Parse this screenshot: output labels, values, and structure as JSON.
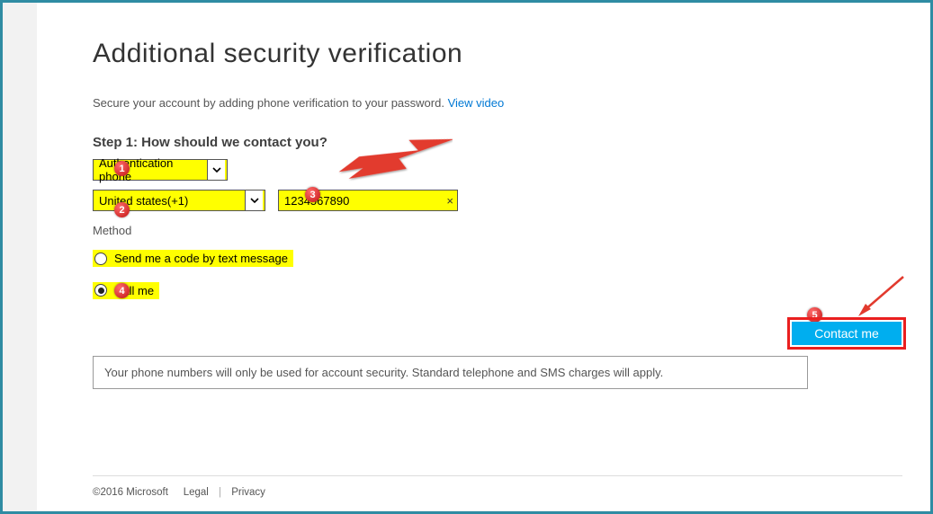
{
  "header": {
    "title": "Additional security verification"
  },
  "subtitle": {
    "text": "Secure your account by adding phone verification to your password. ",
    "link": "View video"
  },
  "step": {
    "title": "Step 1: How should we contact you?"
  },
  "auth_method": {
    "selected": "Authentication phone"
  },
  "country": {
    "selected": "United states(+1)"
  },
  "phone": {
    "value": "1234567890"
  },
  "method_label": "Method",
  "options": {
    "text": "Send me a code by text message",
    "call": "Call me",
    "selected": "call"
  },
  "cta": {
    "label": "Contact me"
  },
  "notice": "Your phone numbers will only be used for account security. Standard telephone and SMS charges will apply.",
  "footer": {
    "copyright": "©2016 Microsoft",
    "legal": "Legal",
    "privacy": "Privacy"
  },
  "annotations": {
    "1": "1",
    "2": "2",
    "3": "3",
    "4": "4",
    "5": "5"
  }
}
